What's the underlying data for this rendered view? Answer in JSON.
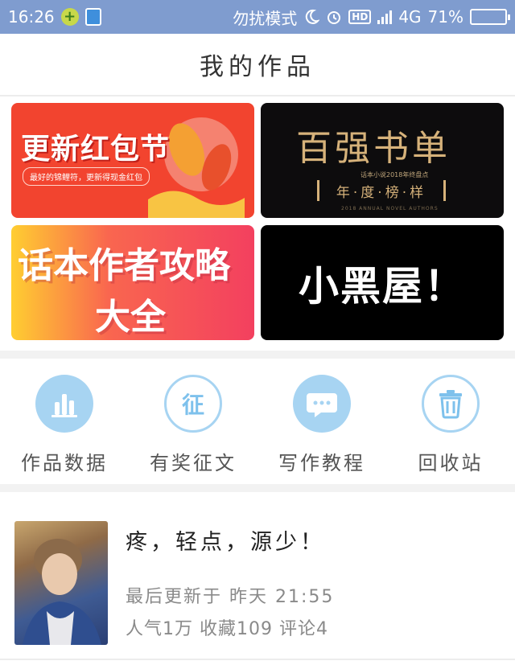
{
  "status_bar": {
    "time": "16:26",
    "mode": "勿扰模式",
    "hd": "HD",
    "network": "4G",
    "battery_percent": "71%",
    "battery_level": 0.71
  },
  "header": {
    "title": "我的作品"
  },
  "banners": [
    {
      "title": "更新红包节",
      "subtitle": "最好的锦鲤符，更新得现金红包"
    },
    {
      "title": "百强书单",
      "small": "话本小说2018年终盘点",
      "box": "年·度·榜·样",
      "footer": "2018 ANNUAL NOVEL AUTHORS"
    },
    {
      "line1": "话本作者攻略",
      "line2": "大全"
    },
    {
      "title": "小黑屋！"
    }
  ],
  "actions": [
    {
      "label": "作品数据",
      "icon": "bar-chart-icon"
    },
    {
      "label": "有奖征文",
      "icon": "zheng-icon",
      "glyph": "征"
    },
    {
      "label": "写作教程",
      "icon": "chat-bubble-icon"
    },
    {
      "label": "回收站",
      "icon": "trash-icon"
    }
  ],
  "work": {
    "title": "疼，轻点，源少！",
    "updated": "最后更新于 昨天 21:55",
    "stats": "人气1万 收藏109 评论4"
  },
  "colors": {
    "status_bar": "#7f9ccf",
    "icon_blue": "#a7d4f2",
    "banner_red": "#f2442f",
    "banner_gold": "#d6b27a"
  }
}
